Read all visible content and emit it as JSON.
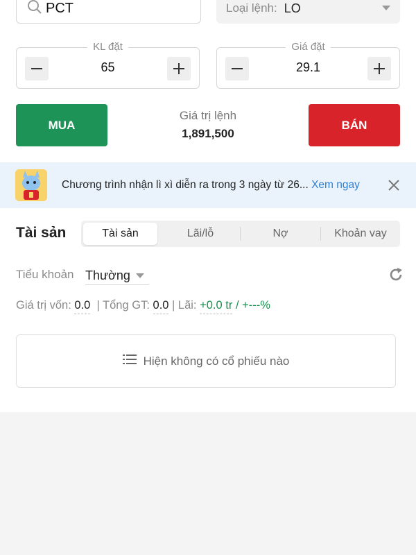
{
  "order_form": {
    "search_value": "PCT",
    "order_type_label": "Loại lệnh:",
    "order_type_value": "LO",
    "quantity_label": "KL đặt",
    "quantity_value": "65",
    "price_label": "Giá đặt",
    "price_value": "29.1",
    "buy_label": "MUA",
    "sell_label": "BÁN",
    "order_value_label": "Giá trị lệnh",
    "order_value": "1,891,500"
  },
  "promo": {
    "text": "Chương trình nhận lì xì diễn ra trong 3 ngày từ 26...",
    "link": "Xem ngay"
  },
  "assets": {
    "title": "Tài sản",
    "tabs": [
      {
        "label": "Tài sản",
        "active": true
      },
      {
        "label": "Lãi/lỗ",
        "active": false
      },
      {
        "label": "Nợ",
        "active": false
      },
      {
        "label": "Khoản vay",
        "active": false
      }
    ],
    "sub_account_label": "Tiểu khoản",
    "sub_account_value": "Thường",
    "capital_label": "Giá trị vốn:",
    "capital_value": "0.0",
    "total_label": "| Tổng GT:",
    "total_value": "0.0",
    "profit_label": "| Lãi:",
    "profit_value": "+0.0 tr",
    "profit_sep": "/",
    "profit_pct": "+---%",
    "empty_text": "Hiện không có cổ phiếu nào"
  },
  "colors": {
    "buy": "#1e9357",
    "sell": "#d8232a",
    "link": "#2f7fd1",
    "gain": "#16924e"
  },
  "icons": [
    "search-icon",
    "caret-down-icon",
    "minus-icon",
    "plus-icon",
    "mascot-icon",
    "close-icon",
    "refresh-icon",
    "list-icon"
  ]
}
